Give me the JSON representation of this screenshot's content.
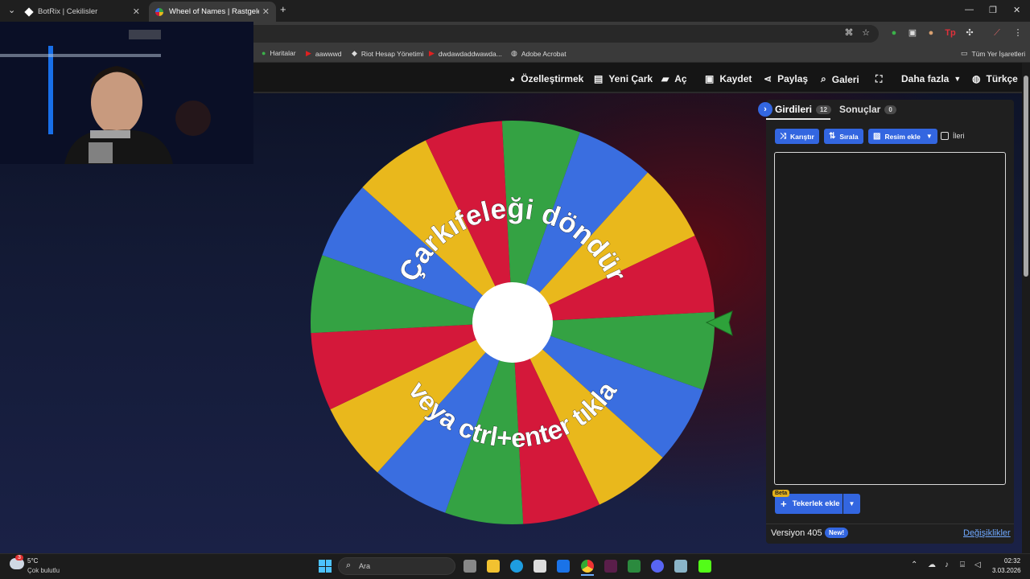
{
  "browser": {
    "tabs": [
      {
        "title": "BotRix | Cekilisler",
        "active": false
      },
      {
        "title": "Wheel of Names | Rastgele ad",
        "active": true
      }
    ],
    "new_tab": "+",
    "bookmarks": [
      {
        "label": "Haritalar",
        "icon": "map-pin-icon"
      },
      {
        "label": "aawwwd",
        "icon": "youtube-icon"
      },
      {
        "label": "Riot Hesap Yönetimi",
        "icon": "riot-icon"
      },
      {
        "label": "dwdawdaddwawda...",
        "icon": "youtube-icon"
      },
      {
        "label": "Adobe Acrobat",
        "icon": "globe-icon"
      }
    ],
    "all_bookmarks": "Tüm Yer İşaretleri"
  },
  "navbar": {
    "items": [
      {
        "label": "Özelleştirmek",
        "icon": "palette-icon"
      },
      {
        "label": "Yeni Çark",
        "icon": "file-icon"
      },
      {
        "label": "Aç",
        "icon": "folder-icon"
      },
      {
        "label": "Kaydet",
        "icon": "save-icon"
      },
      {
        "label": "Paylaş",
        "icon": "share-icon"
      },
      {
        "label": "Galeri",
        "icon": "search-icon"
      },
      {
        "label": "",
        "icon": "fullscreen-icon"
      },
      {
        "label": "Daha fazla",
        "icon": "chevron-down-icon"
      },
      {
        "label": "Türkçe",
        "icon": "globe-icon"
      }
    ]
  },
  "wheel": {
    "top_text": "Çarkıfeleği döndür",
    "bottom_text": "veya ctrl+enter tıkla",
    "colors": {
      "green": "#34a243",
      "yellow": "#e9b81c",
      "red": "#d4183a",
      "blue": "#3a6ee0"
    },
    "pointer_color": "#2ea23a"
  },
  "panel": {
    "tabs": [
      {
        "label": "Girdileri",
        "count": "12",
        "active": true
      },
      {
        "label": "Sonuçlar",
        "count": "0",
        "active": false
      }
    ],
    "buttons": {
      "shuffle": "Karıştır",
      "sort": "Sırala",
      "add_image": "Resim ekle"
    },
    "advanced_label": "İleri",
    "advanced_checked": false,
    "entries_text": "",
    "beta": "Beta",
    "add_wheel": "Tekerlek ekle",
    "version": "Versiyon 405",
    "new_badge": "New!",
    "changes_link": "Değişiklikler"
  },
  "taskbar": {
    "weather_temp": "5°C",
    "weather_desc": "Çok bulutlu",
    "weather_badge": "3",
    "search": "Ara",
    "time": "02:32",
    "date": "3.03.2026"
  }
}
